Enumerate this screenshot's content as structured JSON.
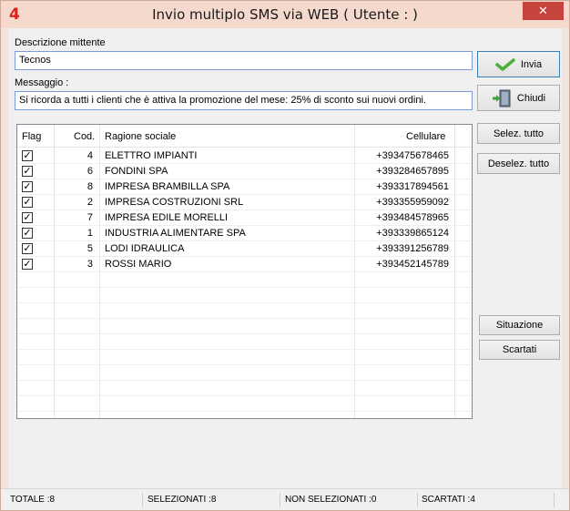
{
  "window": {
    "app_icon": "4",
    "title": "Invio multiplo SMS via WEB ( Utente :  )",
    "close_glyph": "✕"
  },
  "form": {
    "sender_label": "Descrizione mittente",
    "sender_value": "Tecnos",
    "message_label": "Messaggio :",
    "message_value": "Si ricorda a tutti i clienti che è attiva la promozione del mese: 25% di sconto sui nuovi ordini."
  },
  "buttons": {
    "send": "Invia",
    "close": "Chiudi",
    "select_all": "Selez. tutto",
    "deselect_all": "Deselez. tutto",
    "status": "Situazione",
    "discarded": "Scartati"
  },
  "grid": {
    "headers": {
      "flag": "Flag",
      "code": "Cod.",
      "name": "Ragione sociale",
      "phone": "Cellulare"
    },
    "rows": [
      {
        "checked": true,
        "code": "4",
        "name": "ELETTRO IMPIANTI",
        "phone": "+393475678465"
      },
      {
        "checked": true,
        "code": "6",
        "name": "FONDINI SPA",
        "phone": "+393284657895"
      },
      {
        "checked": true,
        "code": "8",
        "name": "IMPRESA BRAMBILLA SPA",
        "phone": "+393317894561"
      },
      {
        "checked": true,
        "code": "2",
        "name": "IMPRESA COSTRUZIONI SRL",
        "phone": "+393355959092"
      },
      {
        "checked": true,
        "code": "7",
        "name": "IMPRESA EDILE MORELLI",
        "phone": "+393484578965"
      },
      {
        "checked": true,
        "code": "1",
        "name": "INDUSTRIA ALIMENTARE SPA",
        "phone": "+393339865124"
      },
      {
        "checked": true,
        "code": "5",
        "name": "LODI IDRAULICA",
        "phone": "+393391256789"
      },
      {
        "checked": true,
        "code": "3",
        "name": "ROSSI MARIO",
        "phone": "+393452145789"
      }
    ],
    "check_glyph": "✓"
  },
  "status": {
    "total": "TOTALE :8",
    "selected": "SELEZIONATI :8",
    "unselected": "NON SELEZIONATI :0",
    "discarded": "SCARTATI :4"
  },
  "colors": {
    "accent": "#d9251d",
    "title_bar": "#f4d9cc",
    "field_border": "#7a9cd3"
  }
}
